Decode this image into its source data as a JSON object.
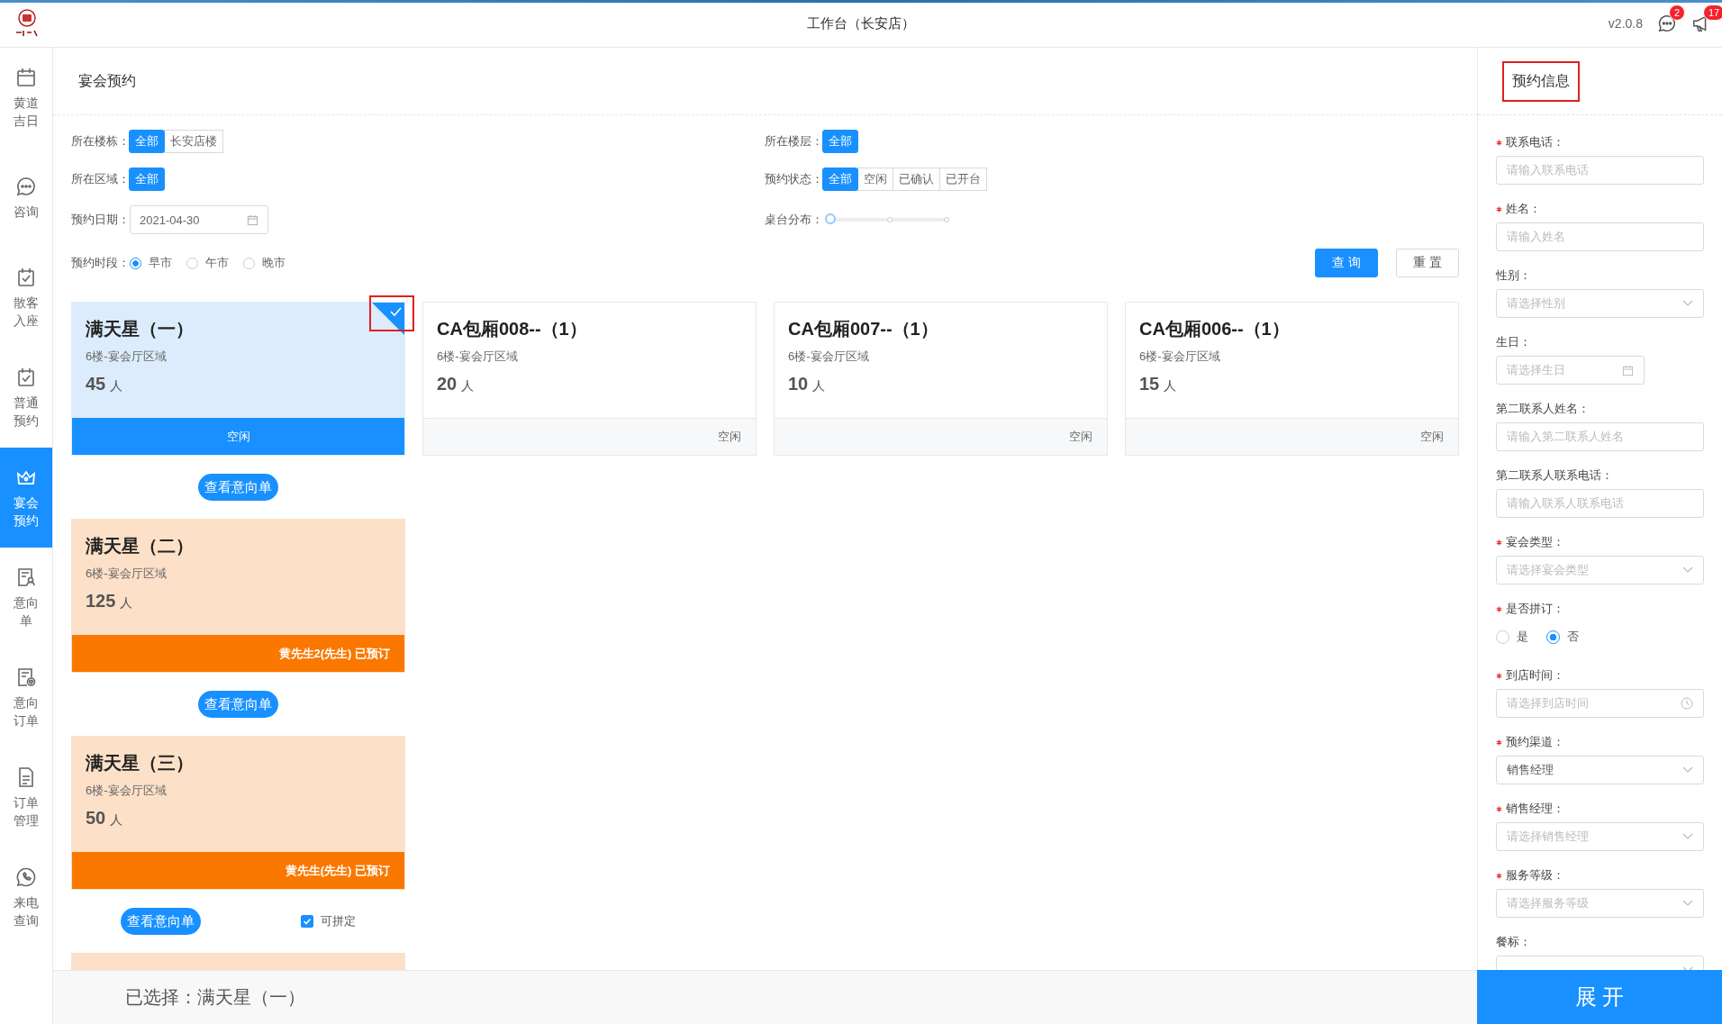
{
  "app": {
    "title": "工作台（长安店）",
    "version": "v2.0.8",
    "messages_badge": "2",
    "notices_badge": "17"
  },
  "sidebar": {
    "items": [
      {
        "label": "黄道吉日",
        "selected": false
      },
      {
        "label": "咨询",
        "selected": false
      },
      {
        "label": "散客入座",
        "selected": false
      },
      {
        "label": "普通预约",
        "selected": false
      },
      {
        "label": "宴会预约",
        "selected": true
      },
      {
        "label": "意向单",
        "selected": false
      },
      {
        "label": "意向订单",
        "selected": false
      },
      {
        "label": "订单管理",
        "selected": false
      },
      {
        "label": "来电查询",
        "selected": false
      }
    ]
  },
  "page": {
    "title": "宴会预约"
  },
  "filters": [
    {
      "kind": "segment",
      "label": "所在楼栋：",
      "options": [
        {
          "label": "全部",
          "selected": true
        },
        {
          "label": "长安店楼",
          "selected": false
        }
      ]
    },
    {
      "kind": "segment",
      "label": "所在楼层：",
      "options": [
        {
          "label": "全部",
          "selected": true
        }
      ]
    },
    {
      "kind": "segment",
      "label": "所在区域：",
      "options": [
        {
          "label": "全部",
          "selected": true
        }
      ]
    },
    {
      "kind": "segment",
      "label": "预约状态：",
      "options": [
        {
          "label": "全部",
          "selected": true
        },
        {
          "label": "空闲",
          "selected": false
        },
        {
          "label": "已确认",
          "selected": false
        },
        {
          "label": "已开台",
          "selected": false
        }
      ]
    },
    {
      "kind": "date",
      "label": "预约日期：",
      "value": "2021-04-30"
    },
    {
      "kind": "slider",
      "label": "桌台分布：",
      "level": 0
    },
    {
      "kind": "radio",
      "label": "预约时段：",
      "options": [
        {
          "label": "早市",
          "selected": true
        },
        {
          "label": "午市",
          "selected": false
        },
        {
          "label": "晚市",
          "selected": false
        }
      ]
    }
  ],
  "actions": [
    {
      "label": "查 询",
      "kind": "primary"
    },
    {
      "label": "重 置",
      "kind": "default"
    }
  ],
  "room_columns": [
    {
      "rooms": [
        {
          "name": "满天星（一）",
          "area": "6楼-宴会厅区域",
          "capacity": "45",
          "unit": "人",
          "status": "空闲",
          "booked": false,
          "selected": true,
          "highlighted": true,
          "intent_button": "查看意向单"
        },
        {
          "name": "满天星（二）",
          "area": "6楼-宴会厅区域",
          "capacity": "125",
          "unit": "人",
          "status": "黄先生2(先生) 已预订",
          "booked": true,
          "selected": false,
          "intent_button": "查看意向单"
        },
        {
          "name": "满天星（三）",
          "area": "6楼-宴会厅区域",
          "capacity": "50",
          "unit": "人",
          "status": "黄先生(先生) 已预订",
          "booked": true,
          "selected": false,
          "intent_button": "查看意向单",
          "mergeable": {
            "label": "可拼定",
            "checked": true
          }
        },
        {
          "booked": true,
          "selected": false
        }
      ]
    },
    {
      "rooms": [
        {
          "name": "CA包厢008--（1）",
          "area": "6楼-宴会厅区域",
          "capacity": "20",
          "unit": "人",
          "status": "空闲",
          "booked": false,
          "selected": false
        }
      ]
    },
    {
      "rooms": [
        {
          "name": "CA包厢007--（1）",
          "area": "6楼-宴会厅区域",
          "capacity": "10",
          "unit": "人",
          "status": "空闲",
          "booked": false,
          "selected": false
        }
      ]
    },
    {
      "rooms": [
        {
          "name": "CA包厢006--（1）",
          "area": "6楼-宴会厅区域",
          "capacity": "15",
          "unit": "人",
          "status": "空闲",
          "booked": false,
          "selected": false
        }
      ]
    }
  ],
  "form": {
    "title": "预约信息",
    "highlighted": true,
    "fields": [
      {
        "kind": "input",
        "label": "联系电话：",
        "required": true,
        "placeholder": "请输入联系电话"
      },
      {
        "kind": "input",
        "label": "姓名：",
        "required": true,
        "placeholder": "请输入姓名"
      },
      {
        "kind": "select",
        "label": "性别：",
        "required": false,
        "placeholder": "请选择性别"
      },
      {
        "kind": "date",
        "label": "生日：",
        "required": false,
        "placeholder": "请选择生日"
      },
      {
        "kind": "input",
        "label": "第二联系人姓名：",
        "required": false,
        "placeholder": "请输入第二联系人姓名"
      },
      {
        "kind": "input",
        "label": "第二联系人联系电话：",
        "required": false,
        "placeholder": "请输入联系人联系电话"
      },
      {
        "kind": "select",
        "label": "宴会类型：",
        "required": true,
        "placeholder": "请选择宴会类型"
      },
      {
        "kind": "radio",
        "label": "是否拼订：",
        "required": true,
        "options": [
          {
            "label": "是",
            "selected": false
          },
          {
            "label": "否",
            "selected": true
          }
        ]
      },
      {
        "kind": "time",
        "label": "到店时间：",
        "required": true,
        "placeholder": "请选择到店时间"
      },
      {
        "kind": "select",
        "label": "预约渠道：",
        "required": true,
        "value": "销售经理"
      },
      {
        "kind": "select",
        "label": "销售经理：",
        "required": true,
        "placeholder": "请选择销售经理"
      },
      {
        "kind": "select",
        "label": "服务等级：",
        "required": true,
        "placeholder": "请选择服务等级"
      },
      {
        "kind": "select",
        "label": "餐标：",
        "required": false
      }
    ]
  },
  "footer": {
    "selection": "已选择：满天星（一）",
    "expand_button": "展 开"
  }
}
